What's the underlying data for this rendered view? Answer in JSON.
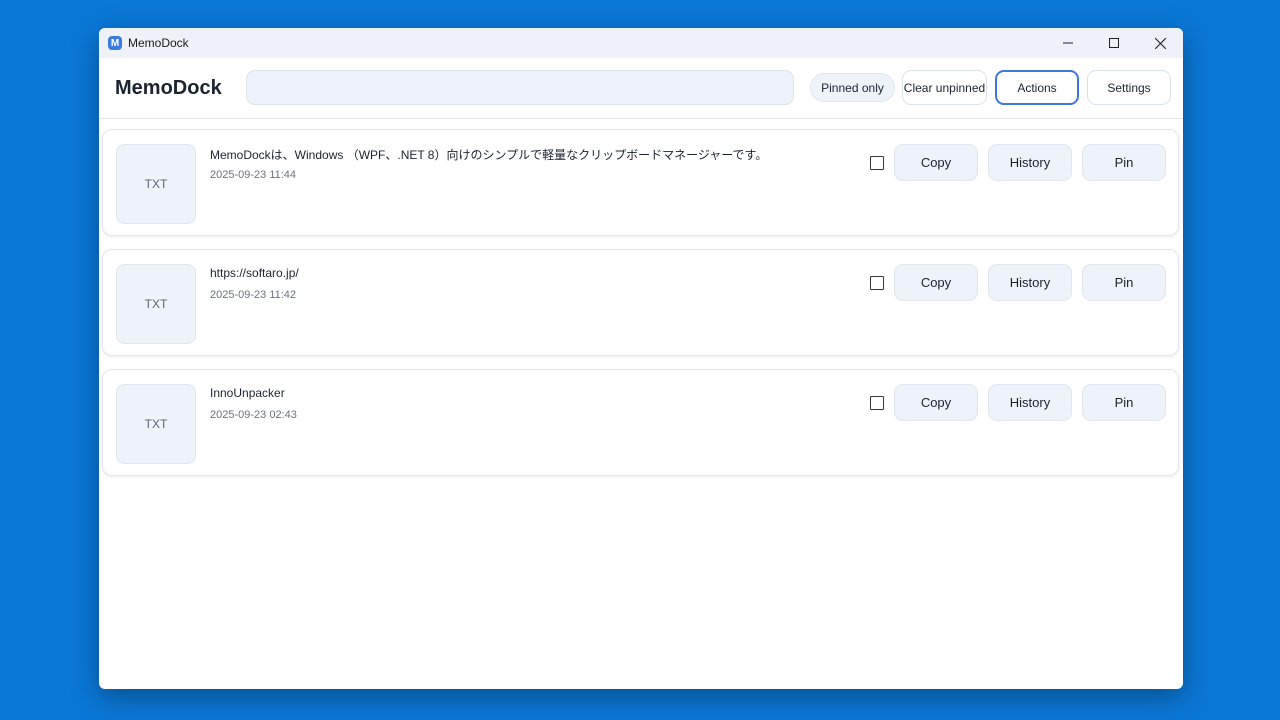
{
  "window": {
    "title": "MemoDock",
    "logo_letter": "M"
  },
  "header": {
    "brand": "MemoDock",
    "search": {
      "value": "",
      "placeholder": ""
    },
    "pinned_only_label": "Pinned only",
    "clear_unpinned_label": "Clear unpinned",
    "actions_label": "Actions",
    "settings_label": "Settings"
  },
  "items": [
    {
      "kind": "TXT",
      "text": "MemoDockは、Windows （WPF、.NET 8）向けのシンプルで軽量なクリップボードマネージャーです。",
      "date": "2025-09-23 11:44",
      "copy_label": "Copy",
      "history_label": "History",
      "pin_label": "Pin"
    },
    {
      "kind": "TXT",
      "text": "https://softaro.jp/",
      "date": "2025-09-23 11:42",
      "copy_label": "Copy",
      "history_label": "History",
      "pin_label": "Pin"
    },
    {
      "kind": "TXT",
      "text": "InnoUnpacker",
      "date": "2025-09-23 02:43",
      "copy_label": "Copy",
      "history_label": "History",
      "pin_label": "Pin"
    }
  ],
  "colors": {
    "desktop": "#0a78d7",
    "accent": "#3b78e0",
    "chip_bg": "#eef2f9"
  }
}
